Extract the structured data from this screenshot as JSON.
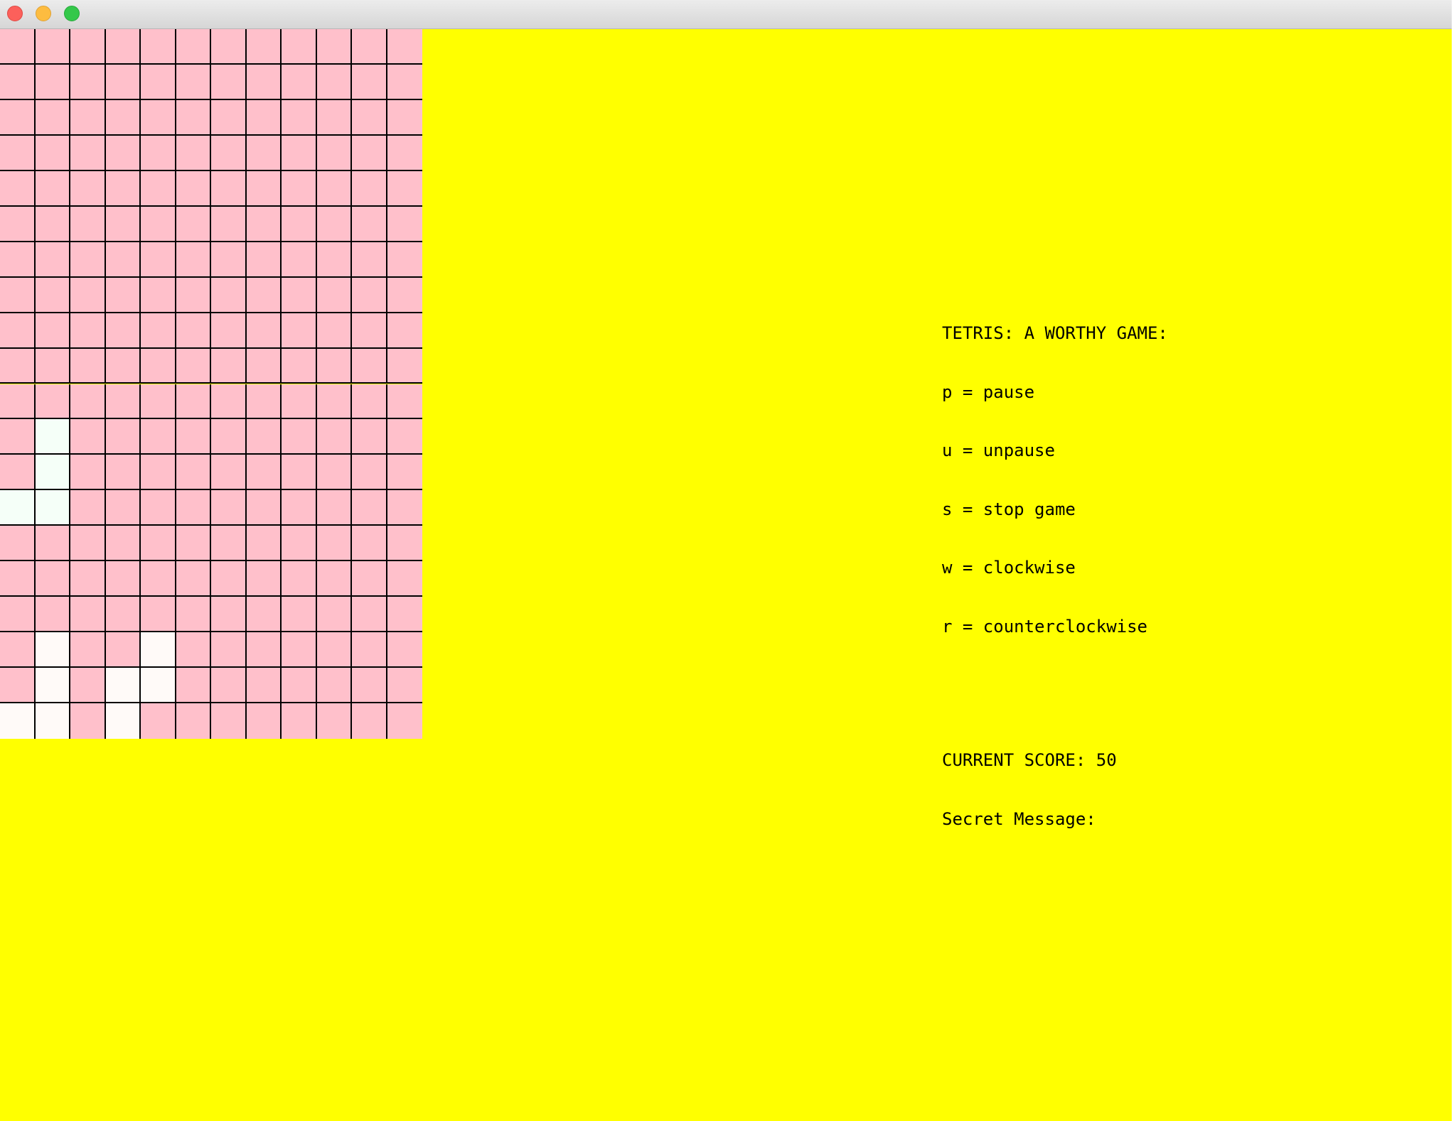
{
  "window": {
    "title": "",
    "buttons": [
      "close",
      "minimize",
      "zoom"
    ]
  },
  "colors": {
    "background": "#ffff00",
    "cell_empty": "#ffc0cb",
    "cell_filled": "#fffaf8",
    "grid_line": "#000000"
  },
  "board": {
    "columns": 12,
    "rows": 20,
    "filled_cells": [
      [
        11,
        1
      ],
      [
        12,
        1
      ],
      [
        13,
        0
      ],
      [
        13,
        1
      ],
      [
        17,
        1
      ],
      [
        17,
        4
      ],
      [
        18,
        1
      ],
      [
        18,
        3
      ],
      [
        18,
        4
      ],
      [
        19,
        0
      ],
      [
        19,
        1
      ],
      [
        19,
        3
      ]
    ]
  },
  "info": {
    "title": "TETRIS: A WORTHY GAME:",
    "controls": [
      "p = pause",
      "u = unpause",
      "s = stop game",
      "w = clockwise",
      "r = counterclockwise"
    ],
    "score_label": "CURRENT SCORE: 50",
    "secret_label": "Secret Message:"
  }
}
